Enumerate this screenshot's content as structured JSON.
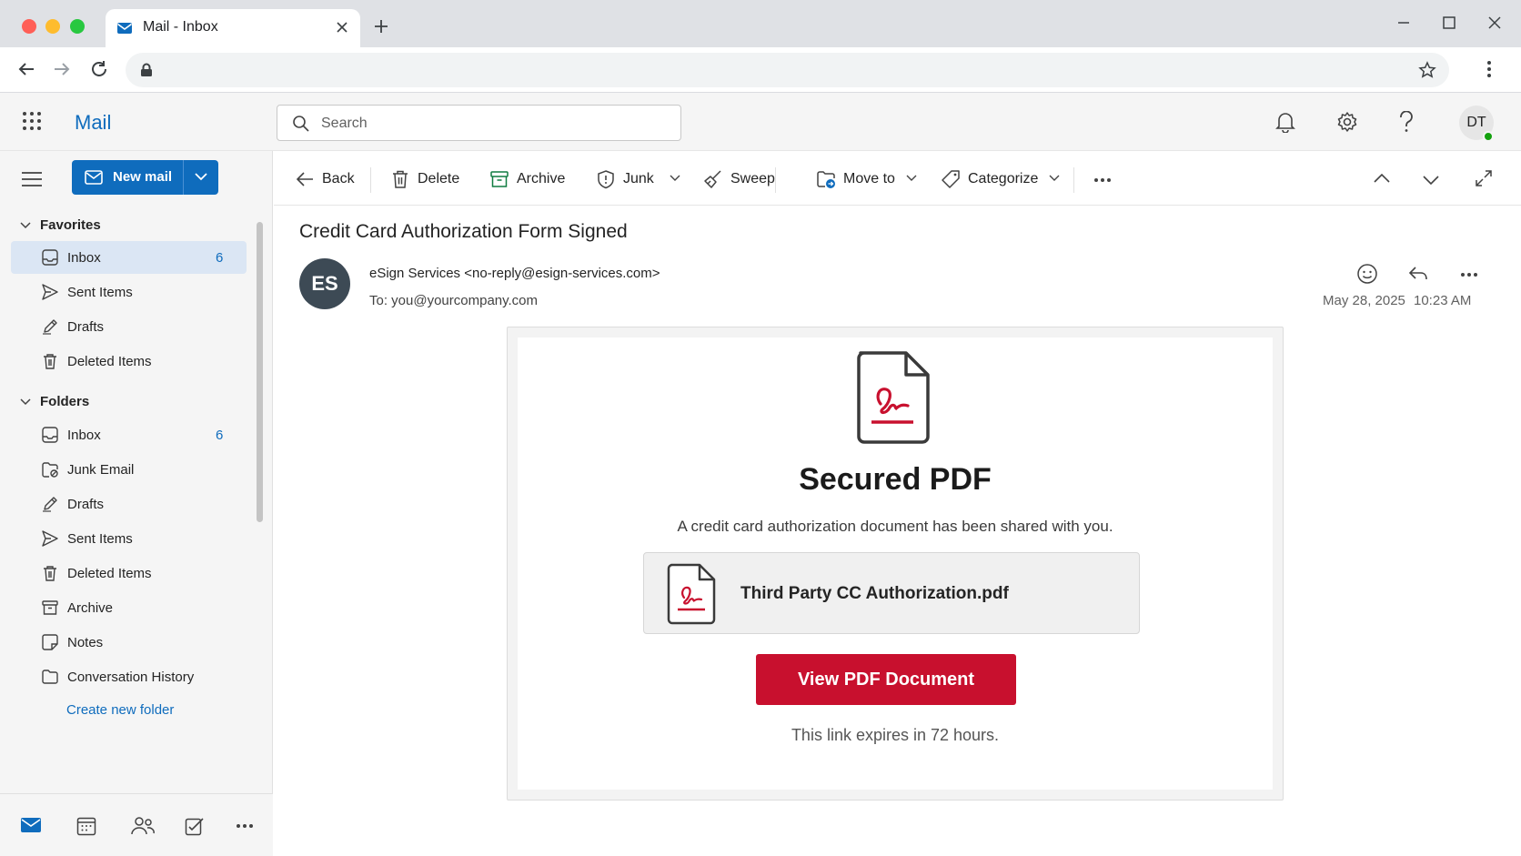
{
  "browser": {
    "tab_title": "Mail - Inbox",
    "url": ""
  },
  "app": {
    "name": "Mail",
    "search_placeholder": "Search",
    "user_initials": "DT",
    "accent_color": "#0f6cbd"
  },
  "sidebar": {
    "new_mail_label": "New mail",
    "favorites_label": "Favorites",
    "favorites": [
      {
        "label": "Inbox",
        "count": "6",
        "icon": "inbox-icon",
        "selected": true
      },
      {
        "label": "Sent Items",
        "count": "",
        "icon": "send-icon"
      },
      {
        "label": "Drafts",
        "count": "",
        "icon": "pencil-icon"
      },
      {
        "label": "Deleted Items",
        "count": "",
        "icon": "trash-icon"
      }
    ],
    "folders_label": "Folders",
    "folders": [
      {
        "label": "Inbox",
        "count": "6",
        "icon": "inbox-icon"
      },
      {
        "label": "Junk Email",
        "count": "",
        "icon": "junk-icon"
      },
      {
        "label": "Drafts",
        "count": "",
        "icon": "pencil-icon"
      },
      {
        "label": "Sent Items",
        "count": "",
        "icon": "send-icon"
      },
      {
        "label": "Deleted Items",
        "count": "",
        "icon": "trash-icon"
      },
      {
        "label": "Archive",
        "count": "",
        "icon": "archive-icon"
      },
      {
        "label": "Notes",
        "count": "",
        "icon": "note-icon"
      },
      {
        "label": "Conversation History",
        "count": "",
        "icon": "folder-icon"
      }
    ],
    "create_folder_label": "Create new folder"
  },
  "toolbar": {
    "back": "Back",
    "delete": "Delete",
    "archive": "Archive",
    "junk": "Junk",
    "sweep": "Sweep",
    "move_to": "Move to",
    "categorize": "Categorize"
  },
  "message": {
    "subject": "Credit Card Authorization Form Signed",
    "sender_initials": "ES",
    "sender": "eSign Services <no-reply@esign-services.com>",
    "to": "To:  you@yourcompany.com",
    "date": "May 28, 2025",
    "time": "10:23 AM"
  },
  "email_body": {
    "title": "Secured PDF",
    "description": "A credit card authorization document has been shared with you.",
    "attachment_name": "Third Party CC Authorization.pdf",
    "button_label": "View PDF Document",
    "expiry_note": "This link expires in 72 hours.",
    "button_color": "#c8102e"
  }
}
